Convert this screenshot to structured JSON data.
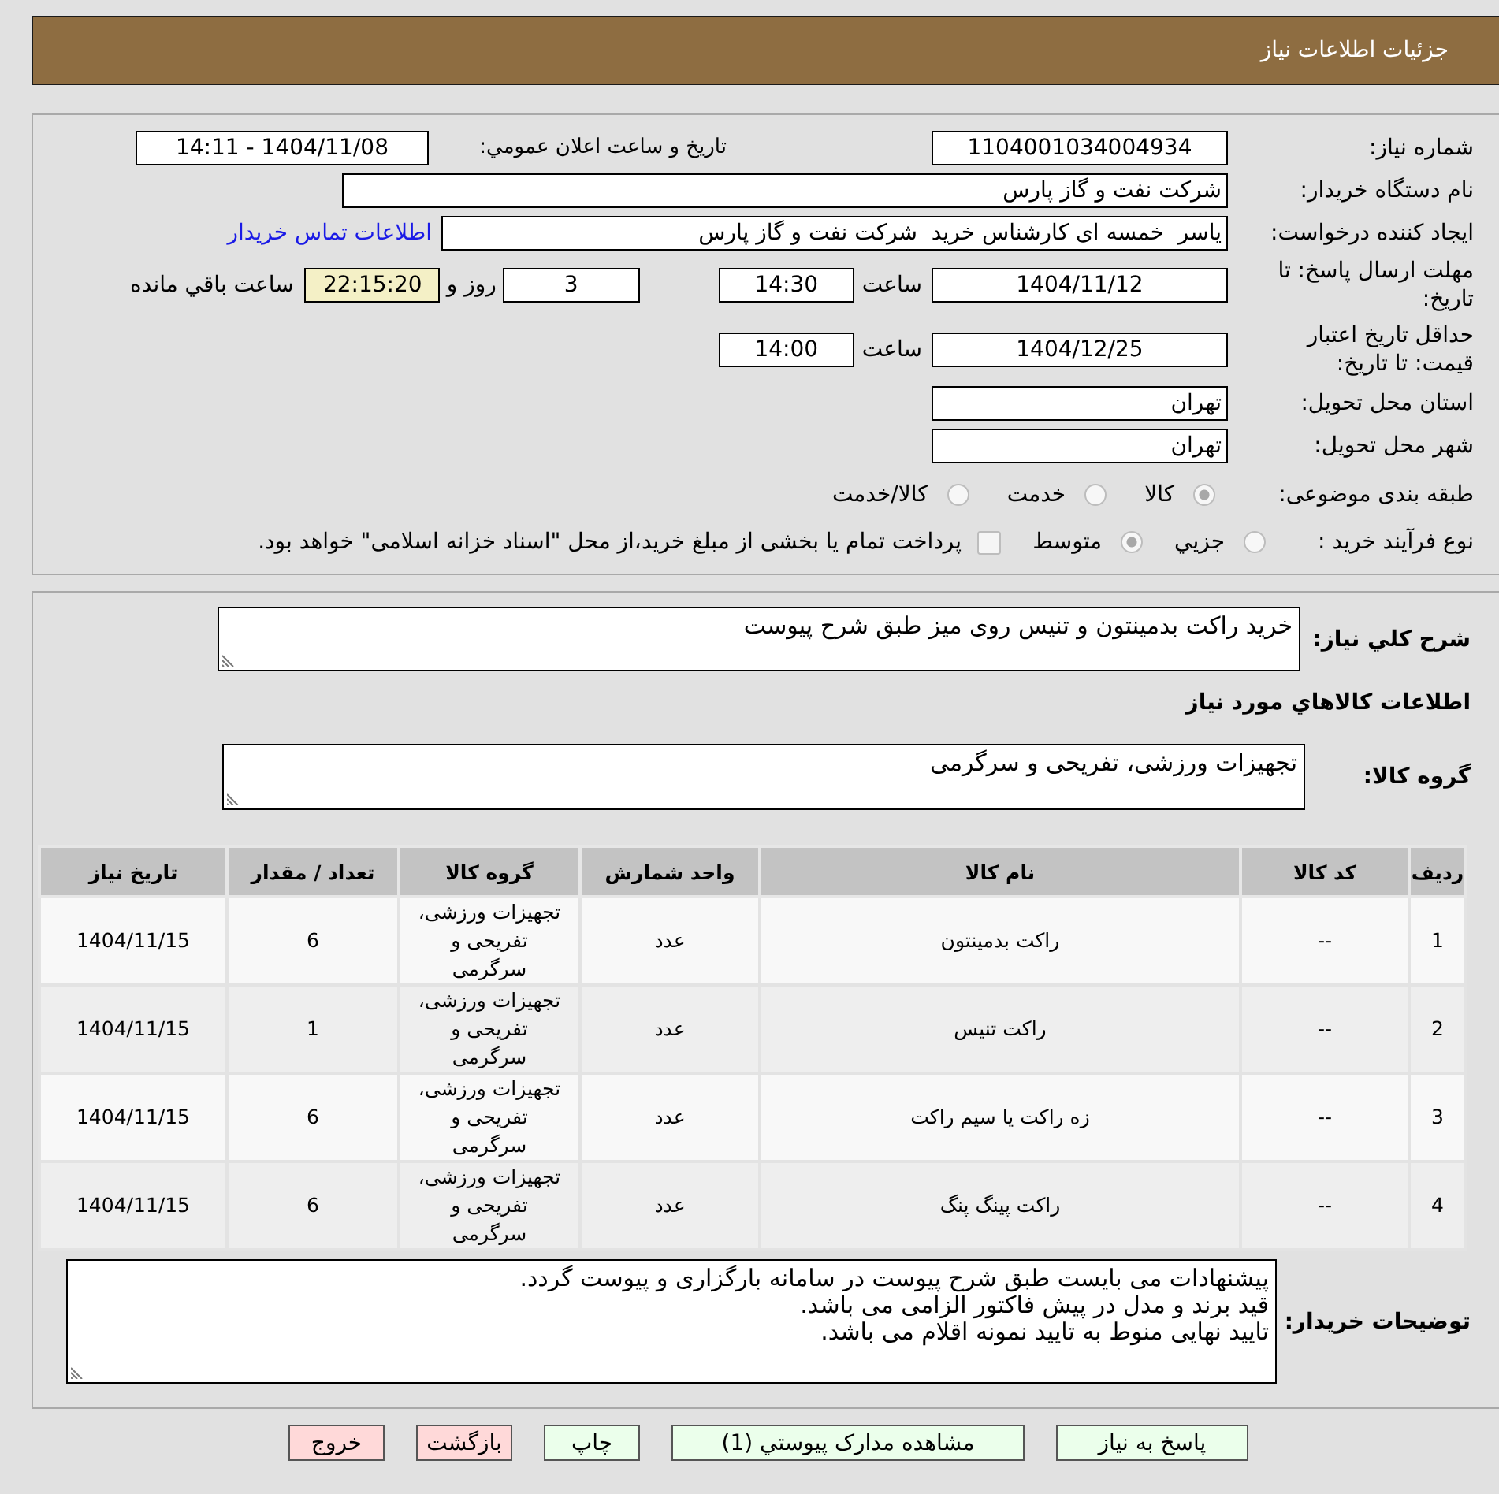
{
  "header": {
    "title": "جزئیات اطلاعات نیاز"
  },
  "details": {
    "need_number": {
      "label": "شماره نیاز:",
      "value": "1104001034004934"
    },
    "announce": {
      "label": "تاریخ و ساعت اعلان عمومي:",
      "value": "1404/11/08 - 14:11"
    },
    "buyer_org": {
      "label": "نام دستگاه خریدار:",
      "value": "شرکت نفت و گاز پارس"
    },
    "requester": {
      "label": "ایجاد کننده درخواست:",
      "value": "یاسر  خمسه ای کارشناس خرید  شرکت نفت و گاز پارس",
      "contact_link": "اطلاعات تماس خریدار"
    },
    "response_deadline": {
      "label": "مهلت ارسال پاسخ: تا تاریخ:",
      "date": "1404/11/12",
      "time_label": "ساعت",
      "time": "14:30",
      "days": "3",
      "days_label": "روز و",
      "remaining": "22:15:20",
      "remaining_label": "ساعت باقي مانده"
    },
    "price_validity": {
      "label": "حداقل تاریخ اعتبار قیمت: تا تاریخ:",
      "date": "1404/12/25",
      "time_label": "ساعت",
      "time": "14:00"
    },
    "delivery_province": {
      "label": "استان محل تحویل:",
      "value": "تهران"
    },
    "delivery_city": {
      "label": "شهر محل تحویل:",
      "value": "تهران"
    },
    "category": {
      "label": "طبقه بندی موضوعی:",
      "options": [
        {
          "label": "کالا",
          "selected": true,
          "disabled": true
        },
        {
          "label": "خدمت",
          "selected": false,
          "disabled": true
        },
        {
          "label": "کالا/خدمت",
          "selected": false,
          "disabled": true
        }
      ]
    },
    "purchase_process": {
      "label": "نوع فرآیند خرید :",
      "options": [
        {
          "label": "جزیي",
          "selected": false,
          "disabled": true
        },
        {
          "label": "متوسط",
          "selected": true,
          "disabled": true
        }
      ],
      "treasury": {
        "label": "پرداخت تمام یا بخشی از مبلغ خرید،از محل \"اسناد خزانه اسلامی\" خواهد بود.",
        "checked": false,
        "disabled": true
      }
    }
  },
  "need_info": {
    "summary_label": "شرح کلي نیاز:",
    "summary": "خرید راکت بدمینتون و تنیس روی میز طبق شرح پیوست",
    "goods_heading": "اطلاعات کالاهاي مورد نیاز",
    "group_label": "گروه کالا:",
    "group": "تجهیزات ورزشی، تفریحی و سرگرمی"
  },
  "table": {
    "columns": [
      "ردیف",
      "کد کالا",
      "نام کالا",
      "واحد شمارش",
      "گروه کالا",
      "تعداد / مقدار",
      "تاریخ نیاز"
    ],
    "rows": [
      {
        "cells": [
          "1",
          "--",
          "راکت بدمینتون",
          "عدد",
          "تجهیزات ورزشی، تفریحی و سرگرمی",
          "6",
          "1404/11/15"
        ]
      },
      {
        "cells": [
          "2",
          "--",
          "راکت تنیس",
          "عدد",
          "تجهیزات ورزشی، تفریحی و سرگرمی",
          "1",
          "1404/11/15"
        ]
      },
      {
        "cells": [
          "3",
          "--",
          "زه راکت یا سیم راکت",
          "عدد",
          "تجهیزات ورزشی، تفریحی و سرگرمی",
          "6",
          "1404/11/15"
        ]
      },
      {
        "cells": [
          "4",
          "--",
          "راکت پینگ پنگ",
          "عدد",
          "تجهیزات ورزشی، تفریحی و سرگرمی",
          "6",
          "1404/11/15"
        ]
      }
    ]
  },
  "buyer_notes": {
    "label": "توضیحات خریدار:",
    "lines": [
      "پیشنهادات می بایست طبق شرح پیوست در سامانه بارگزاری و پیوست گردد.",
      "قید برند و مدل در پیش فاکتور الزامی می باشد.",
      "تایید نهایی منوط به تایید نمونه اقلام می باشد."
    ]
  },
  "buttons": [
    {
      "label": "پاسخ به نیاز",
      "kind": "action"
    },
    {
      "label": "مشاهده مدارک پیوستي (1)",
      "kind": "action"
    },
    {
      "label": "چاپ",
      "kind": "action"
    },
    {
      "label": "بازگشت",
      "kind": "exit"
    },
    {
      "label": "خروج",
      "kind": "exit"
    }
  ]
}
